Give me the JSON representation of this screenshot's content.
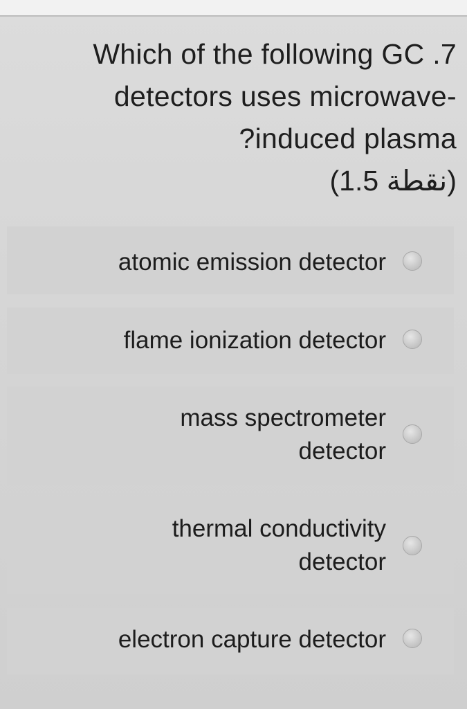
{
  "question": {
    "lines": [
      "Which of the following GC .7",
      "detectors uses microwave-",
      "?induced plasma",
      "(نقطة 1.5)"
    ]
  },
  "options": [
    {
      "lines": [
        "atomic emission detector"
      ],
      "selected": false
    },
    {
      "lines": [
        "flame ionization detector"
      ],
      "selected": false
    },
    {
      "lines": [
        "mass spectrometer",
        "detector"
      ],
      "selected": false
    },
    {
      "lines": [
        "thermal conductivity",
        "detector"
      ],
      "selected": false
    },
    {
      "lines": [
        "electron capture detector"
      ],
      "selected": false
    }
  ],
  "colors": {
    "background": "#d6d6d6",
    "option_background": "#d2d2d2",
    "text": "#1c1c1c",
    "radio": "#c8c8c8"
  },
  "icons": {
    "radio": "radio-unselected-icon"
  }
}
